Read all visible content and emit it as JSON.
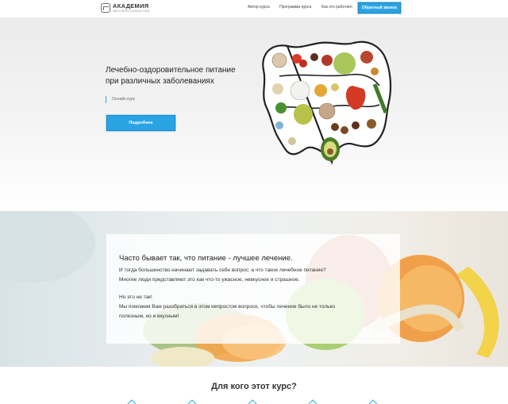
{
  "header": {
    "logo_title": "АКАДЕМИЯ",
    "logo_subtitle": "WELLNESS CONSULTING",
    "nav": [
      "Автор курса",
      "Программа курса",
      "Как это работает"
    ],
    "callback_button": "Обратный звонок"
  },
  "hero": {
    "title_line1": "Лечебно-оздоровительное питание",
    "title_line2": "при различных заболеваниях",
    "tag": "Онлайн курс",
    "more_button": "Подробнее"
  },
  "intro": {
    "title": "Часто бывает так, что питание - лучшее лечение.",
    "lines": [
      "И тогда большинство начинают задавать себе вопрос: а что такое лечебное питание?",
      "Многие люди представляют это как что-то ужасное, невкусное и страшное.",
      "",
      "Но это не так!",
      "Мы поможем Вам разобраться в этом непростом вопросе, чтобы лечение было не только",
      "полезным, но и вкусным!"
    ]
  },
  "audience": {
    "title": "Для кого этот курс?"
  },
  "colors": {
    "accent": "#2aa3e3",
    "text": "#222222"
  }
}
